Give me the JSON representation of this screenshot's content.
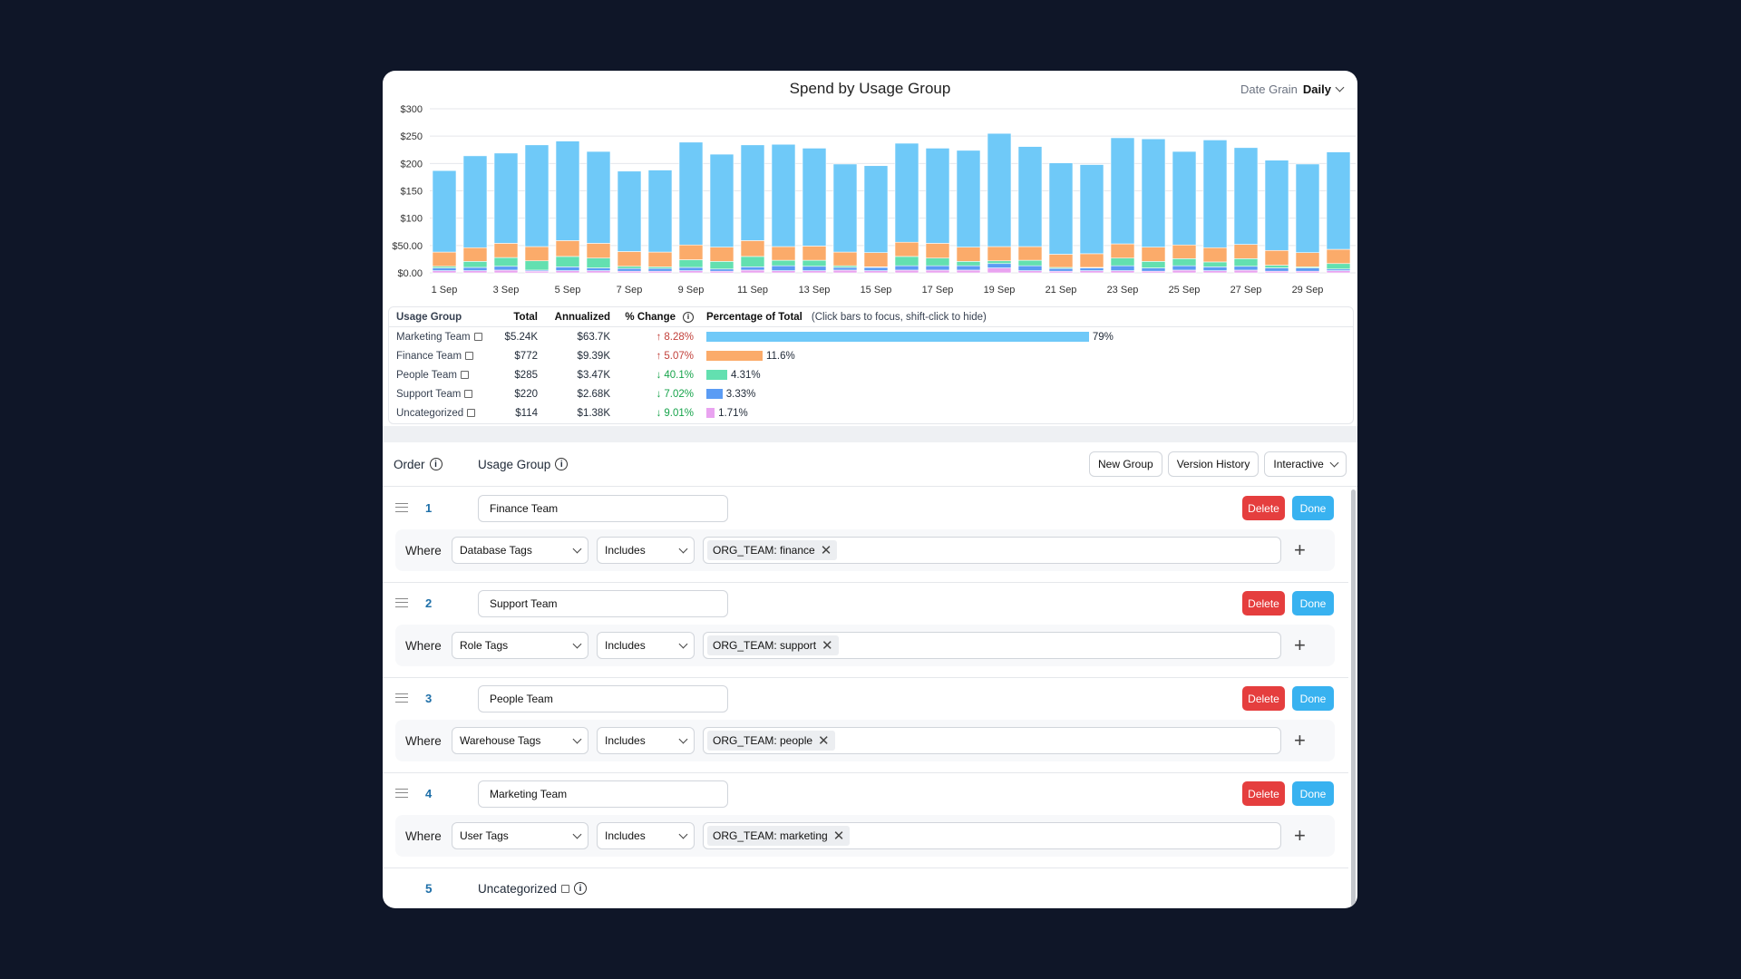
{
  "header": {
    "title": "Spend by Usage Group",
    "date_grain_label": "Date Grain",
    "date_grain_value": "Daily"
  },
  "chart_data": {
    "type": "bar",
    "stacked": true,
    "title": "Spend by Usage Group",
    "ylim": [
      0,
      300
    ],
    "yticks": [
      "$0.00",
      "$50.00",
      "$100",
      "$150",
      "$200",
      "$250",
      "$300"
    ],
    "ytick_values": [
      0,
      50,
      100,
      150,
      200,
      250,
      300
    ],
    "categories": [
      "1 Sep",
      "2 Sep",
      "3 Sep",
      "4 Sep",
      "5 Sep",
      "6 Sep",
      "7 Sep",
      "8 Sep",
      "9 Sep",
      "10 Sep",
      "11 Sep",
      "12 Sep",
      "13 Sep",
      "14 Sep",
      "15 Sep",
      "16 Sep",
      "17 Sep",
      "18 Sep",
      "19 Sep",
      "20 Sep",
      "21 Sep",
      "22 Sep",
      "23 Sep",
      "24 Sep",
      "25 Sep",
      "26 Sep",
      "27 Sep",
      "28 Sep",
      "29 Sep",
      "30 Sep"
    ],
    "xtick_labels": [
      "1 Sep",
      "3 Sep",
      "5 Sep",
      "7 Sep",
      "9 Sep",
      "11 Sep",
      "13 Sep",
      "15 Sep",
      "17 Sep",
      "19 Sep",
      "21 Sep",
      "23 Sep",
      "25 Sep",
      "27 Sep",
      "29 Sep"
    ],
    "grid": true,
    "series": [
      {
        "name": "Uncategorized",
        "color": "#e9a3f0",
        "values": [
          4,
          4,
          5,
          3,
          4,
          4,
          3,
          3,
          4,
          3,
          5,
          4,
          4,
          5,
          4,
          5,
          5,
          5,
          9,
          4,
          3,
          4,
          4,
          3,
          5,
          4,
          5,
          3,
          3,
          4
        ]
      },
      {
        "name": "Support Team",
        "color": "#5b9cf4",
        "values": [
          5,
          6,
          7,
          2,
          7,
          5,
          5,
          5,
          6,
          4,
          6,
          9,
          8,
          5,
          6,
          8,
          8,
          8,
          8,
          9,
          5,
          5,
          9,
          6,
          8,
          7,
          7,
          6,
          6,
          3
        ]
      },
      {
        "name": "People Team",
        "color": "#63e0b0",
        "values": [
          3,
          11,
          16,
          17,
          19,
          18,
          4,
          3,
          14,
          14,
          19,
          10,
          11,
          3,
          1,
          17,
          14,
          8,
          5,
          10,
          2,
          1,
          14,
          12,
          13,
          9,
          14,
          5,
          2,
          10
        ]
      },
      {
        "name": "Finance Team",
        "color": "#fbab6a",
        "values": [
          26,
          25,
          26,
          26,
          29,
          27,
          27,
          27,
          27,
          26,
          29,
          25,
          26,
          25,
          26,
          26,
          27,
          26,
          26,
          25,
          24,
          25,
          26,
          26,
          25,
          26,
          26,
          27,
          26,
          26
        ]
      },
      {
        "name": "Marketing Team",
        "color": "#6fc9f8",
        "values": [
          149,
          168,
          165,
          186,
          182,
          168,
          147,
          150,
          188,
          170,
          175,
          187,
          179,
          161,
          159,
          181,
          174,
          177,
          207,
          183,
          167,
          163,
          194,
          198,
          171,
          197,
          177,
          165,
          162,
          178
        ]
      }
    ]
  },
  "summary": {
    "headers": {
      "group": "Usage Group",
      "total": "Total",
      "annualized": "Annualized",
      "change": "% Change",
      "pct": "Percentage of Total",
      "hint": "(Click bars to focus, shift-click to hide)"
    },
    "rows": [
      {
        "group": "Marketing Team",
        "total": "$5.24K",
        "annualized": "$63.7K",
        "change": "8.28%",
        "dir": "up",
        "pct_label": "79%",
        "pct": 79,
        "color": "#6fc9f8"
      },
      {
        "group": "Finance Team",
        "total": "$772",
        "annualized": "$9.39K",
        "change": "5.07%",
        "dir": "up",
        "pct_label": "11.6%",
        "pct": 11.6,
        "color": "#fbab6a"
      },
      {
        "group": "People Team",
        "total": "$285",
        "annualized": "$3.47K",
        "change": "40.1%",
        "dir": "down",
        "pct_label": "4.31%",
        "pct": 4.31,
        "color": "#63e0b0"
      },
      {
        "group": "Support Team",
        "total": "$220",
        "annualized": "$2.68K",
        "change": "7.02%",
        "dir": "down",
        "pct_label": "3.33%",
        "pct": 3.33,
        "color": "#5b9cf4"
      },
      {
        "group": "Uncategorized",
        "total": "$114",
        "annualized": "$1.38K",
        "change": "9.01%",
        "dir": "down",
        "pct_label": "1.71%",
        "pct": 1.71,
        "color": "#e9a3f0"
      }
    ]
  },
  "groups_header": {
    "order": "Order",
    "usage_group": "Usage Group",
    "new_group": "New Group",
    "version_history": "Version History",
    "mode": "Interactive"
  },
  "groups": [
    {
      "order": "1",
      "name": "Finance Team",
      "field": "Database Tags",
      "op": "Includes",
      "tag": "ORG_TEAM: finance"
    },
    {
      "order": "2",
      "name": "Support Team",
      "field": "Role Tags",
      "op": "Includes",
      "tag": "ORG_TEAM: support"
    },
    {
      "order": "3",
      "name": "People Team",
      "field": "Warehouse Tags",
      "op": "Includes",
      "tag": "ORG_TEAM: people"
    },
    {
      "order": "4",
      "name": "Marketing Team",
      "field": "User Tags",
      "op": "Includes",
      "tag": "ORG_TEAM: marketing"
    }
  ],
  "labels": {
    "where": "Where",
    "delete": "Delete",
    "done": "Done"
  },
  "uncategorized": {
    "order": "5",
    "name": "Uncategorized"
  }
}
